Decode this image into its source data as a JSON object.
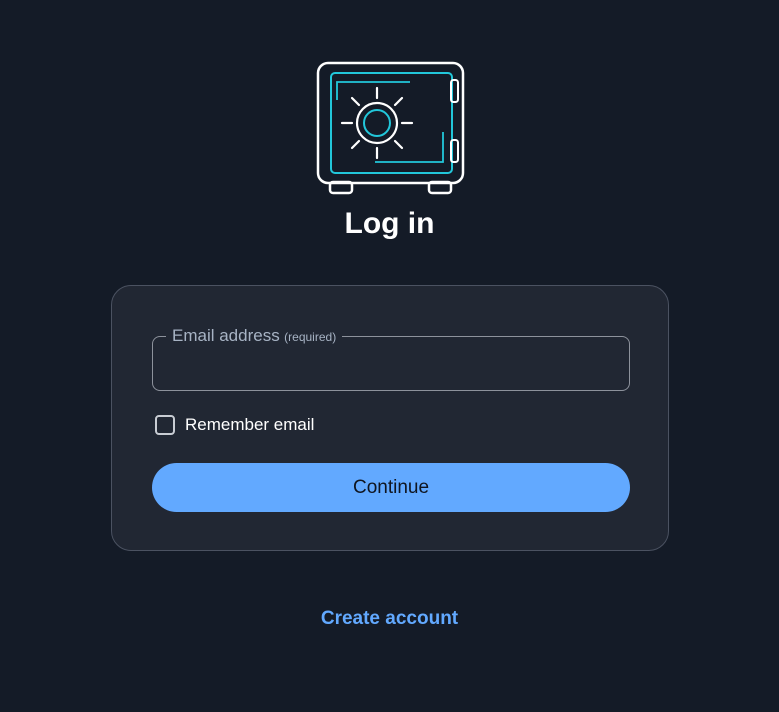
{
  "logo": {
    "icon": "safe-icon"
  },
  "title": "Log in",
  "form": {
    "email_label": "Email address",
    "email_required": "(required)",
    "email_value": "",
    "remember_label": "Remember email",
    "remember_checked": false,
    "continue_label": "Continue"
  },
  "footer": {
    "create_account": "Create account"
  },
  "colors": {
    "background": "#141b27",
    "card": "#212733",
    "accent": "#62a9ff",
    "logo_accent": "#22c7da"
  }
}
